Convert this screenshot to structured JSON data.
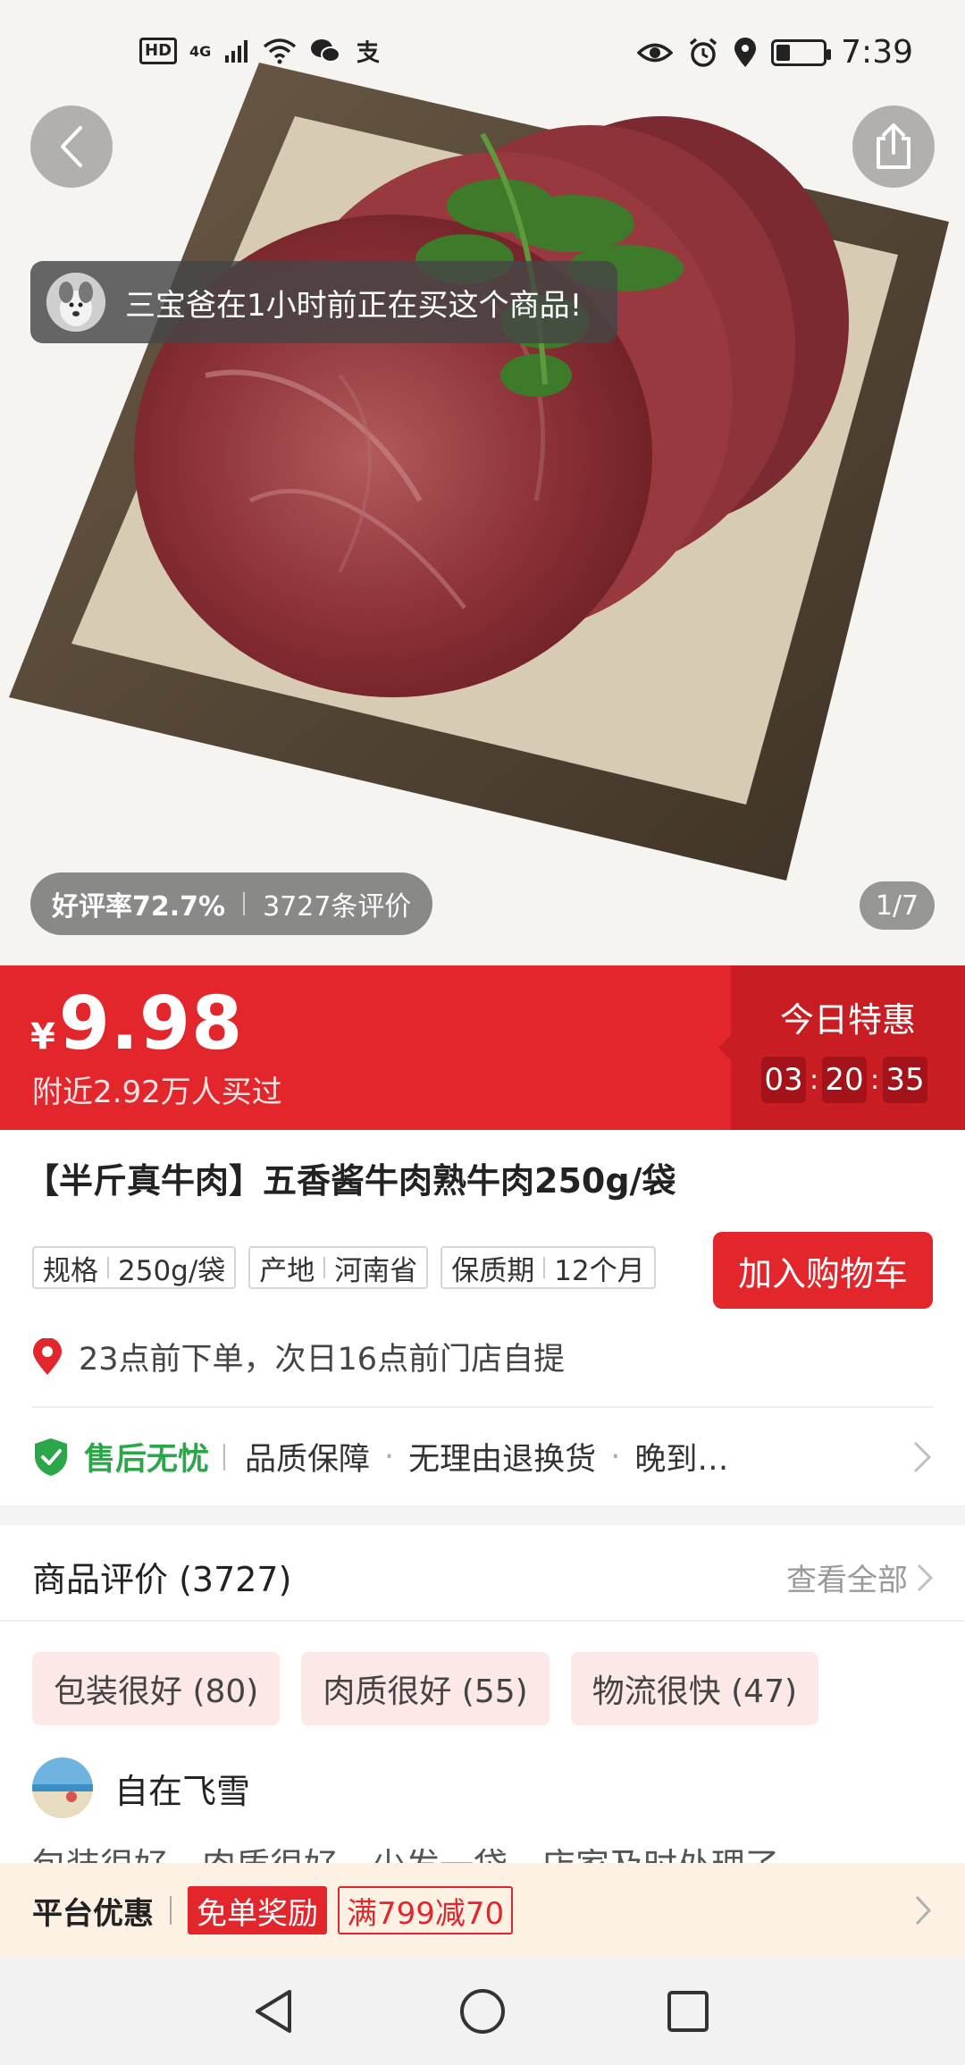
{
  "status_bar": {
    "hd": "HD",
    "network": "4G",
    "time": "7:39",
    "battery_level": 0.3
  },
  "product_image": {
    "buyer_toast": "三宝爸在1小时前正在买这个商品!",
    "rating_good": "好评率72.7%",
    "rating_count": "3727条评价",
    "page_indicator": "1/7"
  },
  "price_bar": {
    "currency": "¥",
    "price": "9.98",
    "buyers": "附近2.92万人买过",
    "deal_label": "今日特惠",
    "countdown": {
      "h": "03",
      "m": "20",
      "s": "35"
    }
  },
  "product": {
    "title": "【半斤真牛肉】五香酱牛肉熟牛肉250g/袋",
    "specs": [
      {
        "key": "规格",
        "value": "250g/袋"
      },
      {
        "key": "产地",
        "value": "河南省"
      },
      {
        "key": "保质期",
        "value": "12个月"
      }
    ],
    "add_to_cart": "加入购物车",
    "pickup_info": "23点前下单，次日16点前门店自提",
    "guarantee_title": "售后无忧",
    "guarantee_items": [
      "品质保障",
      "无理由退换货",
      "晚到…"
    ]
  },
  "reviews": {
    "header": "商品评价 (3727)",
    "view_all": "查看全部",
    "tags": [
      "包装很好 (80)",
      "肉质很好 (55)",
      "物流很快 (47)"
    ],
    "reviewer_name": "自在飞雪",
    "review_text": "包装很好，肉质很好，少发一袋，店家及时处理了"
  },
  "promo": {
    "label": "平台优惠",
    "free_order": "免单奖励",
    "coupon": "满799减70"
  },
  "colors": {
    "accent_red": "#e2262c",
    "guarantee_green": "#2ba74a"
  },
  "icons": [
    "back-arrow-icon",
    "share-icon",
    "location-pin-icon",
    "shield-check-icon",
    "chevron-right-icon",
    "nav-back-icon",
    "nav-home-icon",
    "nav-recent-icon"
  ]
}
